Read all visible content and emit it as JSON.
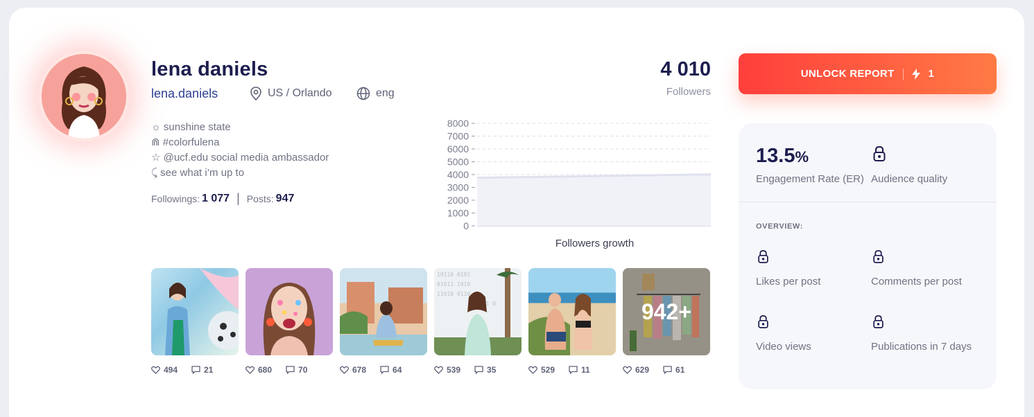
{
  "profile": {
    "name": "lena daniels",
    "handle": "lena.daniels",
    "location": "US / Orlando",
    "language": "eng",
    "bio": [
      "☼ sunshine state",
      "⋒ #colorfulena",
      "☆ @ucf.edu social media ambassador",
      "⤹ see what i’m up to"
    ],
    "followings_label": "Followings:",
    "followings": "1 077",
    "posts_label": "Posts:",
    "posts": "947",
    "followers": "4 010",
    "followers_label": "Followers"
  },
  "chart_data": {
    "type": "area",
    "title": "",
    "xlabel": "Followers growth",
    "ylabel": "",
    "ylim": [
      0,
      8000
    ],
    "yticks": [
      "8000",
      "7000",
      "6000",
      "5000",
      "4000",
      "3000",
      "2000",
      "1000",
      "0"
    ],
    "series": [
      {
        "values": [
          3750,
          4010
        ]
      }
    ],
    "grid": true
  },
  "posts": [
    {
      "likes": "494",
      "comments": "21"
    },
    {
      "likes": "680",
      "comments": "70"
    },
    {
      "likes": "678",
      "comments": "64"
    },
    {
      "likes": "539",
      "comments": "35"
    },
    {
      "likes": "529",
      "comments": "11"
    },
    {
      "likes": "629",
      "comments": "61",
      "overlay": "942+"
    }
  ],
  "unlock": {
    "label": "UNLOCK REPORT",
    "credits": "1"
  },
  "metrics": {
    "er_value": "13.5",
    "er_unit": "%",
    "er_label": "Engagement Rate (ER)",
    "audience_quality": "Audience quality",
    "overview_title": "OVERVIEW:",
    "likes_per_post": "Likes per post",
    "comments_per_post": "Comments per post",
    "video_views": "Video views",
    "publications_7_days": "Publications in 7 days"
  },
  "colors": {
    "accent_start": "#ff3f3c",
    "accent_end": "#ff7a45",
    "text_dark": "#1c1d4e",
    "link": "#2e3f93"
  }
}
